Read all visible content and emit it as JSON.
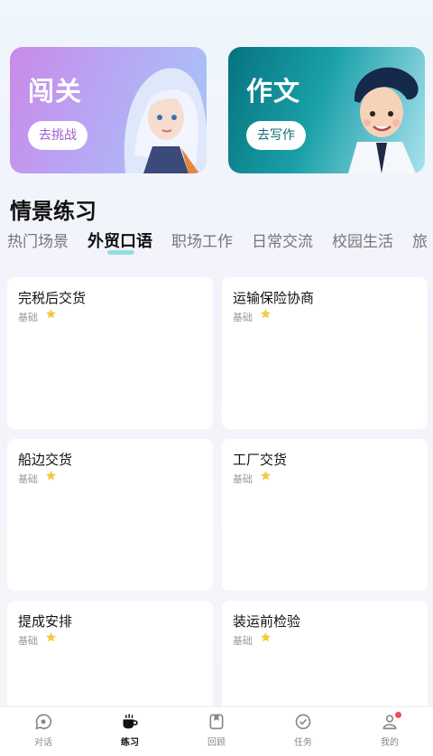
{
  "banners": [
    {
      "title": "闯关",
      "button": "去挑战"
    },
    {
      "title": "作文",
      "button": "去写作"
    }
  ],
  "section_title": "情景练习",
  "tabs": [
    "热门场景",
    "外贸口语",
    "职场工作",
    "日常交流",
    "校园生活",
    "旅"
  ],
  "active_tab": 1,
  "cards": [
    {
      "title": "完税后交货",
      "level": "基础"
    },
    {
      "title": "运输保险协商",
      "level": "基础"
    },
    {
      "title": "船边交货",
      "level": "基础"
    },
    {
      "title": "工厂交货",
      "level": "基础"
    },
    {
      "title": "提成安排",
      "level": "基础"
    },
    {
      "title": "装运前检验",
      "level": "基础"
    }
  ],
  "tabbar": [
    {
      "label": "对话",
      "icon": "chat-icon"
    },
    {
      "label": "练习",
      "icon": "coffee-cup-icon"
    },
    {
      "label": "回顾",
      "icon": "bookmark-icon"
    },
    {
      "label": "任务",
      "icon": "check-circle-icon"
    },
    {
      "label": "我的",
      "icon": "user-icon",
      "badge": true
    }
  ],
  "active_tabbar": 1,
  "colors": {
    "accent": "#7ad9d7",
    "star": "#f7c842",
    "badge": "#f24b5c"
  }
}
